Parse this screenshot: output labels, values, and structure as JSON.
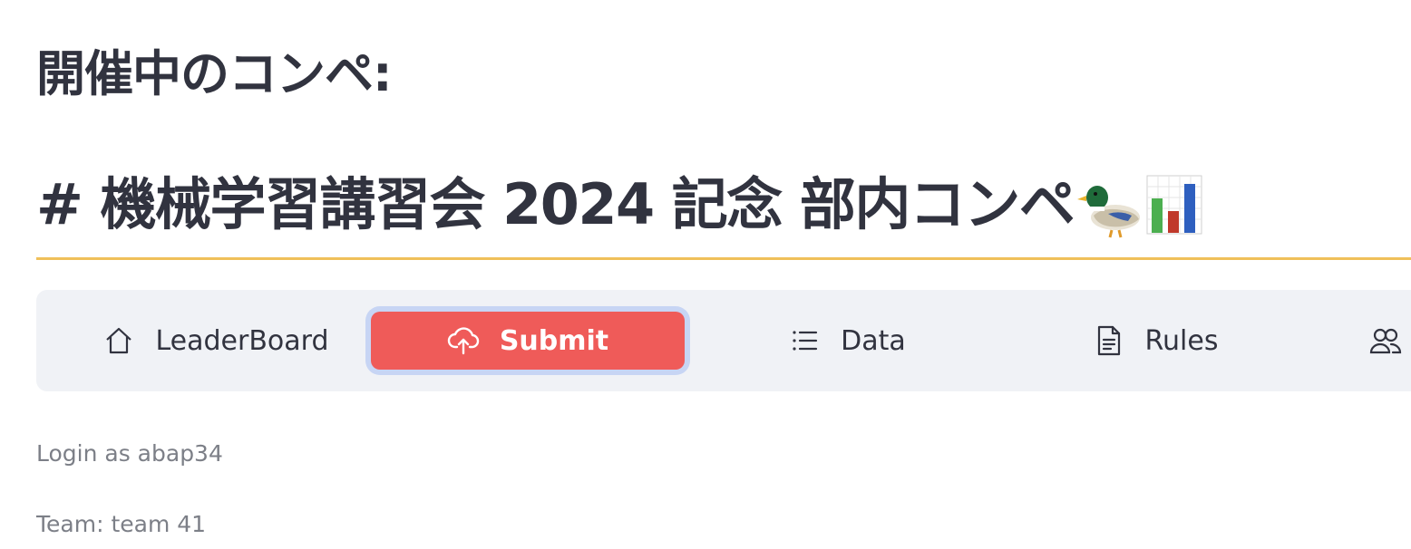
{
  "heading": "開催中のコンペ:",
  "competition_title": "# 機械学習講習会 2024 記念 部内コンペ",
  "title_icons": [
    "duck-icon",
    "bar-chart-icon"
  ],
  "accent_colors": {
    "divider": "#f0c05a",
    "active_tab": "#ef5b59",
    "active_tab_focus_ring": "#c7d5f4",
    "nav_background": "#f0f2f6"
  },
  "nav": {
    "items": [
      {
        "label": "LeaderBoard",
        "icon": "home-icon",
        "active": false
      },
      {
        "label": "Submit",
        "icon": "cloud-upload-icon",
        "active": true
      },
      {
        "label": "Data",
        "icon": "list-icon",
        "active": false
      },
      {
        "label": "Rules",
        "icon": "document-icon",
        "active": false
      },
      {
        "label": "",
        "icon": "team-icon",
        "active": false
      }
    ]
  },
  "user": {
    "login_text": "Login as abap34",
    "team_text": "Team: team 41"
  }
}
